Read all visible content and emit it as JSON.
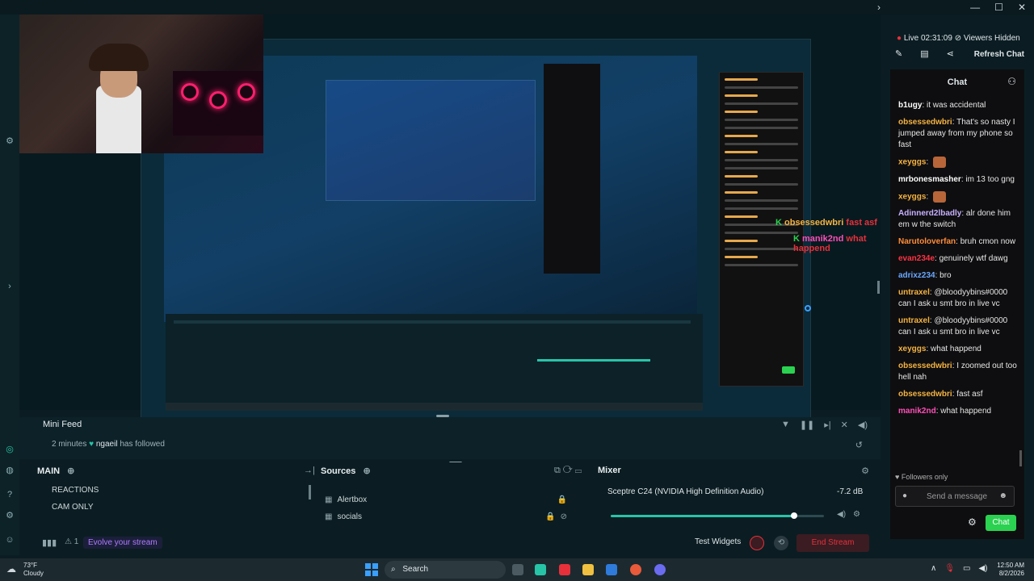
{
  "stream": {
    "live_label": "Live",
    "live_time": "02:31:09",
    "viewers_label": "Viewers Hidden",
    "refresh_chat": "Refresh Chat"
  },
  "chat": {
    "title": "Chat",
    "followers_only": "Followers only",
    "send_placeholder": "Send a message",
    "chat_button": "Chat",
    "messages": [
      {
        "user": "b1ugy",
        "color": "#ffffff",
        "text": "it was accidental"
      },
      {
        "user": "obsessedwbri",
        "color": "#f5b342",
        "text": "That's so nasty I jumped away from my phone so fast"
      },
      {
        "user": "xeyggs",
        "color": "#f5b342",
        "text": ""
      },
      {
        "user": "mrbonesmasher",
        "color": "#ffffff",
        "text": "im 13 too gng"
      },
      {
        "user": "xeyggs",
        "color": "#f5b342",
        "text": ""
      },
      {
        "user": "Adinnerd2lbadly",
        "color": "#c8b0ff",
        "text": "alr done him em w the switch"
      },
      {
        "user": "Narutoloverfan",
        "color": "#ff8c3a",
        "text": "bruh cmon now"
      },
      {
        "user": "evan234e",
        "color": "#ff3344",
        "text": "genuinely wtf dawg"
      },
      {
        "user": "adrixz234",
        "color": "#6aa8ff",
        "text": "bro"
      },
      {
        "user": "untraxel",
        "color": "#f5b342",
        "text": "@bloodyybins#0000 can I ask u smt bro in live vc"
      },
      {
        "user": "untraxel",
        "color": "#f5b342",
        "text": "@bloodyybins#0000 can I ask u smt bro in live vc"
      },
      {
        "user": "xeyggs",
        "color": "#f5b342",
        "text": "what happend"
      },
      {
        "user": "obsessedwbri",
        "color": "#f5b342",
        "text": "I zoomed out too hell nah"
      },
      {
        "user": "obsessedwbri",
        "color": "#f5b342",
        "text": "fast asf"
      },
      {
        "user": "manik2nd",
        "color": "#ff4fb8",
        "text": "what happend"
      }
    ]
  },
  "overlay": {
    "line1_user": "obsessedwbri",
    "line1_text": "fast asf",
    "line2_user": "manik2nd",
    "line2_text": "what happend"
  },
  "mini_feed": {
    "title": "Mini Feed",
    "time": "2 minutes",
    "user": "ngaeil",
    "action": "has followed"
  },
  "scenes": {
    "title": "MAIN",
    "items": [
      "REACTIONS",
      "CAM ONLY"
    ]
  },
  "sources": {
    "title": "Sources",
    "items": [
      "Alertbox",
      "socials"
    ]
  },
  "mixer": {
    "title": "Mixer",
    "device": "Sceptre C24 (NVIDIA High Definition Audio)",
    "db": "-7.2 dB",
    "level": 0.86
  },
  "footer": {
    "promo": "Evolve your stream",
    "alert_count": "1",
    "test_widgets": "Test Widgets",
    "end_stream": "End Stream"
  },
  "taskbar": {
    "weather_temp": "73°F",
    "weather_desc": "Cloudy",
    "search": "Search",
    "time": "12:50 AM",
    "date": "8/2/2026"
  },
  "colors": {
    "accent": "#27c4a8",
    "live_red": "#e8303a",
    "chat_button": "#2bd150",
    "end_stream": "#e8303a"
  }
}
